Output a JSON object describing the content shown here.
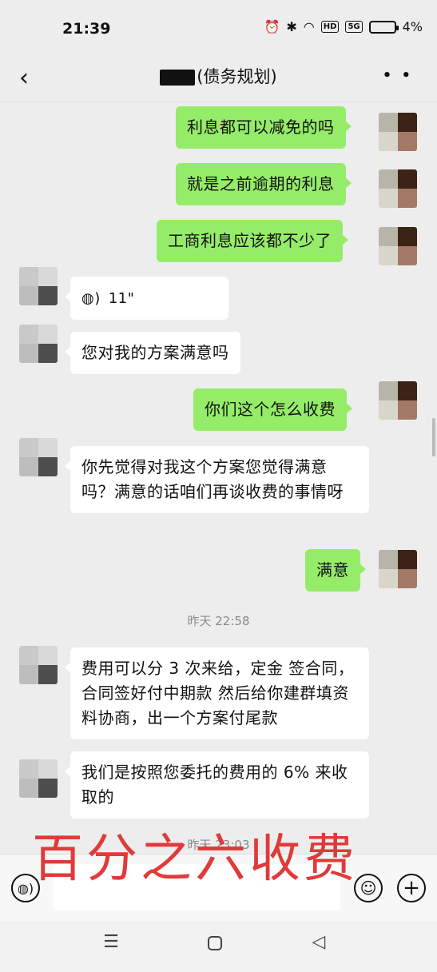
{
  "status": {
    "time": "21:39",
    "battery": "4%",
    "alarm_icon": "alarm-icon",
    "bluetooth_icon": "bluetooth-icon",
    "wifi_icon": "wifi-icon",
    "hd_label": "HD",
    "signal_label": "5G"
  },
  "header": {
    "title": "(债务规划)",
    "back_icon": "chevron-left-icon",
    "more_label": "• •"
  },
  "messages": [
    {
      "side": "me",
      "text": "利息都可以减免的吗"
    },
    {
      "side": "me",
      "text": "就是之前逾期的利息"
    },
    {
      "side": "me",
      "text": "工商利息应该都不少了"
    },
    {
      "side": "them",
      "type": "voice",
      "duration": "11\""
    },
    {
      "side": "them",
      "text": "您对我的方案满意吗"
    },
    {
      "side": "me",
      "text": "你们这个怎么收费"
    },
    {
      "side": "them",
      "text": "你先觉得对我这个方案您觉得满意吗？满意的话咱们再谈收费的事情呀"
    },
    {
      "side": "me",
      "text": "满意"
    },
    {
      "type": "timestamp",
      "text": "昨天 22:58"
    },
    {
      "side": "them",
      "text": "费用可以分 3 次来给，定金 签合同，合同签好付中期款 然后给你建群填资料协商，出一个方案付尾款"
    },
    {
      "side": "them",
      "text": "我们是按照您委托的费用的 6% 来收取的"
    },
    {
      "type": "timestamp",
      "text": "昨天 23:03"
    }
  ],
  "overlay": {
    "caption": "百分之六收费",
    "color": "#e03a3a"
  },
  "input": {
    "placeholder": "",
    "voice_icon": "voice-icon",
    "emoji_icon": "emoji-icon",
    "plus_icon": "plus-icon"
  },
  "system_nav": {
    "menu_icon": "menu-icon",
    "home_icon": "home-icon",
    "back_icon": "back-triangle-icon"
  },
  "colors": {
    "my_bubble": "#95ec69",
    "their_bubble": "#ffffff",
    "background": "#ededed"
  }
}
